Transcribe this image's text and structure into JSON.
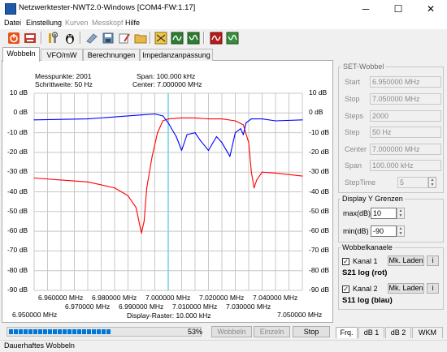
{
  "window": {
    "title": "Netzwerktester-NWT2.0-Windows [COM4-FW:1.17]",
    "min_glyph": "─",
    "max_glyph": "☐",
    "close_glyph": "✕"
  },
  "menu": {
    "items": [
      {
        "label": "Datei",
        "enabled": true
      },
      {
        "label": "Einstellung",
        "enabled": true
      },
      {
        "label": "Kurven",
        "enabled": false
      },
      {
        "label": "Messkopf",
        "enabled": false
      },
      {
        "label": "Hilfe",
        "enabled": true
      }
    ]
  },
  "toolbar": {
    "icons": [
      "power-icon",
      "display-icon",
      "settings-icon",
      "tux-icon",
      "open-file-icon",
      "save-icon",
      "erase-icon",
      "folder-icon",
      "calc-icon",
      "wave-curve-icon",
      "wave-curve-alt-icon",
      "wave-curve-red-icon",
      "wave-curve-green-icon"
    ]
  },
  "tabs": [
    {
      "label": "Wobbeln",
      "active": true
    },
    {
      "label": "VFO/mW",
      "active": false
    },
    {
      "label": "Berechnungen",
      "active": false
    },
    {
      "label": "Impedanzanpassung",
      "active": false
    }
  ],
  "plot_info": {
    "messpunkte": "Messpunkte: 2001",
    "schrittweite": "Schrittweite:  50 Hz",
    "span": "Span: 100.000 kHz",
    "center": "Center: 7.000000 MHz",
    "raster": "Display-Raster: 10.000 kHz",
    "x_start": "6.950000 MHz",
    "x_end": "7.050000 MHz"
  },
  "chart_data": {
    "type": "line",
    "xlim": [
      6.95,
      7.05
    ],
    "ylim": [
      -90,
      10
    ],
    "y_ticks": [
      "10 dB",
      "0 dB",
      "-10 dB",
      "-20 dB",
      "-30 dB",
      "-40 dB",
      "-50 dB",
      "-60 dB",
      "-70 dB",
      "-80 dB",
      "-90 dB"
    ],
    "x_ticks_upper": [
      "6.960000 MHz",
      "6.980000 MHz",
      "7.000000 MHz",
      "7.020000 MHz",
      "7.040000 MHz"
    ],
    "x_ticks_lower": [
      "6.970000 MHz",
      "6.990000 MHz",
      "7.010000 MHz",
      "7.030000 MHz"
    ],
    "marker_x": 7.0,
    "grid": true,
    "series": [
      {
        "name": "S21 log (rot)",
        "color": "#ff0000",
        "x": [
          6.95,
          6.96,
          6.97,
          6.98,
          6.985,
          6.988,
          6.99,
          6.991,
          6.992,
          6.994,
          6.996,
          6.998,
          7.0,
          7.005,
          7.01,
          7.015,
          7.02,
          7.025,
          7.028,
          7.03,
          7.031,
          7.032,
          7.033,
          7.035,
          7.04,
          7.05
        ],
        "y": [
          -33,
          -34,
          -35,
          -38,
          -42,
          -48,
          -61,
          -55,
          -38,
          -22,
          -10,
          -4,
          -3,
          -2.5,
          -2.5,
          -3,
          -3,
          -4,
          -6,
          -15,
          -30,
          -38,
          -34,
          -30,
          -30.5,
          -32
        ]
      },
      {
        "name": "S11 log (blau)",
        "color": "#0000ff",
        "x": [
          6.95,
          6.97,
          6.99,
          6.995,
          6.998,
          7.0,
          7.003,
          7.005,
          7.007,
          7.01,
          7.012,
          7.015,
          7.018,
          7.02,
          7.023,
          7.025,
          7.027,
          7.028,
          7.029,
          7.031,
          7.035,
          7.04,
          7.05
        ],
        "y": [
          -3.5,
          -3,
          -1,
          -0.5,
          -1.5,
          -5,
          -12,
          -19,
          -11,
          -10,
          -14,
          -19,
          -12,
          -15,
          -22,
          -10,
          -8,
          -11,
          -5,
          -3,
          -3,
          -4,
          -3.5
        ]
      }
    ]
  },
  "set_wobbel": {
    "title": "SET-Wobbel",
    "rows": [
      {
        "label": "Start",
        "value": "6.950000 MHz"
      },
      {
        "label": "Stop",
        "value": "7.050000 MHz"
      },
      {
        "label": "Steps",
        "value": "2000"
      },
      {
        "label": "Step",
        "value": "50 Hz"
      },
      {
        "label": "Center",
        "value": "7.000000 MHz"
      },
      {
        "label": "Span",
        "value": "100.000 kHz"
      }
    ],
    "steptime_label": "StepTime",
    "steptime_value": "5"
  },
  "display_y": {
    "title": "Display Y Grenzen",
    "max_label": "max(dB)",
    "max_value": "10",
    "min_label": "min(dB)",
    "min_value": "-90"
  },
  "wobbelkanaele": {
    "title": "Wobbelkanaele",
    "channels": [
      {
        "label": "Kanal 1",
        "checked": true,
        "load_label": "Mk. Laden",
        "info_label": "i",
        "desc": "S21 log (rot)"
      },
      {
        "label": "Kanal 2",
        "checked": true,
        "load_label": "Mk. Laden",
        "info_label": "i",
        "desc": "S11 log (blau)"
      }
    ]
  },
  "controls": {
    "progress": 0.53,
    "progress_text": "53%",
    "wobbeln_label": "Wobbeln",
    "einzeln_label": "Einzeln",
    "stop_label": "Stop",
    "tabs2": [
      "Frq.",
      "dB 1",
      "dB 2",
      "WKM"
    ]
  },
  "status": {
    "text": "Dauerhaftes Wobbeln"
  }
}
